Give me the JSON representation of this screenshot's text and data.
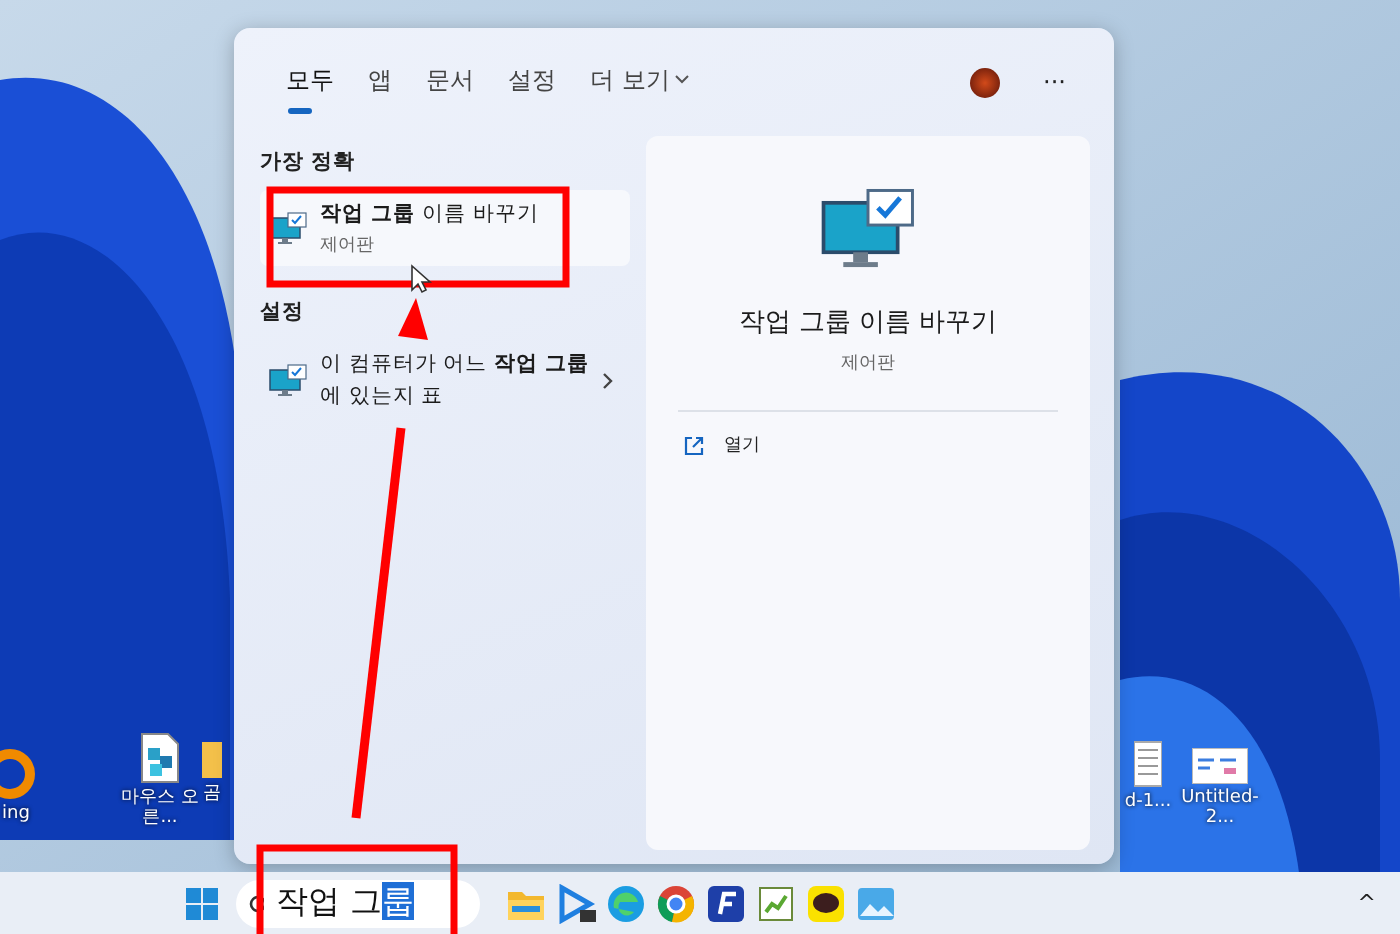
{
  "desktop_icons": [
    {
      "kind": "orange-app",
      "label": "ing"
    },
    {
      "kind": "cubes",
      "label": "마우스 오른..."
    },
    {
      "kind": "folder",
      "label": "곰"
    },
    {
      "kind": "document",
      "label": "d-1..."
    },
    {
      "kind": "screenshot",
      "label": "Untitled-2..."
    }
  ],
  "search_panel": {
    "tabs": [
      {
        "label": "모두",
        "selected": true,
        "dropdown": false
      },
      {
        "label": "앱",
        "selected": false,
        "dropdown": false
      },
      {
        "label": "문서",
        "selected": false,
        "dropdown": false
      },
      {
        "label": "설정",
        "selected": false,
        "dropdown": false
      },
      {
        "label": "더 보기",
        "selected": false,
        "dropdown": true
      }
    ],
    "more_button": "···",
    "sections": [
      {
        "heading": "가장 정확",
        "items": [
          {
            "title": "**작업 그룹** 이름 바꾸기",
            "subtitle": "제어판",
            "selected": true,
            "chevron": false
          }
        ]
      },
      {
        "heading": "설정",
        "items": [
          {
            "title": "이 컴퓨터가 어느 **작업 그룹**에 있는지 표",
            "selected": false,
            "chevron": true
          }
        ]
      }
    ],
    "preview": {
      "title": "작업 그룹 이름 바꾸기",
      "subtitle": "제어판",
      "actions": [
        {
          "label": "열기"
        }
      ]
    }
  },
  "taskbar": {
    "search": {
      "typed": "작업 그",
      "composing": "룹"
    },
    "apps": [
      {
        "kind": "explorer"
      },
      {
        "kind": "player"
      },
      {
        "kind": "edge"
      },
      {
        "kind": "chrome"
      },
      {
        "kind": "f-app"
      },
      {
        "kind": "notepad"
      },
      {
        "kind": "talk"
      },
      {
        "kind": "photos"
      }
    ],
    "tray_chevron": "^"
  },
  "annotations": [
    {
      "kind": "box"
    },
    {
      "kind": "arrow"
    },
    {
      "kind": "box"
    }
  ]
}
